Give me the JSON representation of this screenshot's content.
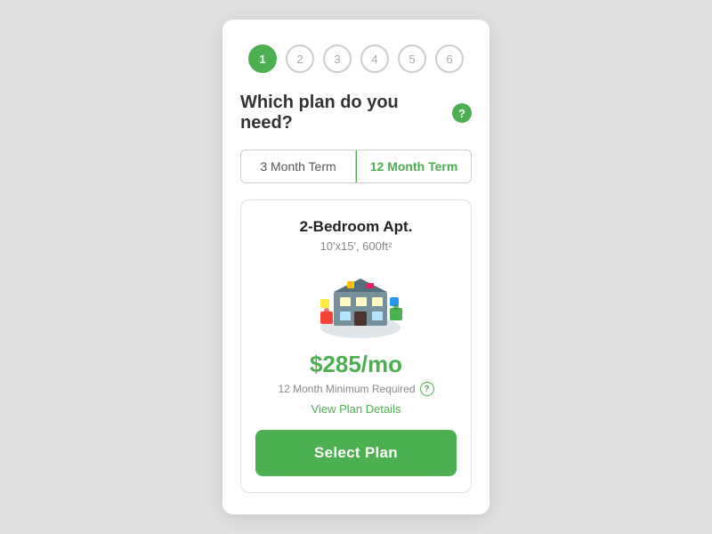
{
  "steps": [
    {
      "label": "1",
      "active": true
    },
    {
      "label": "2",
      "active": false
    },
    {
      "label": "3",
      "active": false
    },
    {
      "label": "4",
      "active": false
    },
    {
      "label": "5",
      "active": false
    },
    {
      "label": "6",
      "active": false
    }
  ],
  "question": {
    "title": "Which plan do you need?",
    "help_label": "?"
  },
  "terms": [
    {
      "label": "3 Month Term",
      "selected": false
    },
    {
      "label": "12 Month Term",
      "selected": true
    }
  ],
  "plan": {
    "name": "2-Bedroom Apt.",
    "size": "10'x15', 600ft²",
    "price": "$285/mo",
    "min_required": "12 Month Minimum Required",
    "view_details": "View Plan Details",
    "select_label": "Select Plan"
  },
  "colors": {
    "green": "#4caf50",
    "text_dark": "#222222",
    "text_gray": "#888888"
  }
}
